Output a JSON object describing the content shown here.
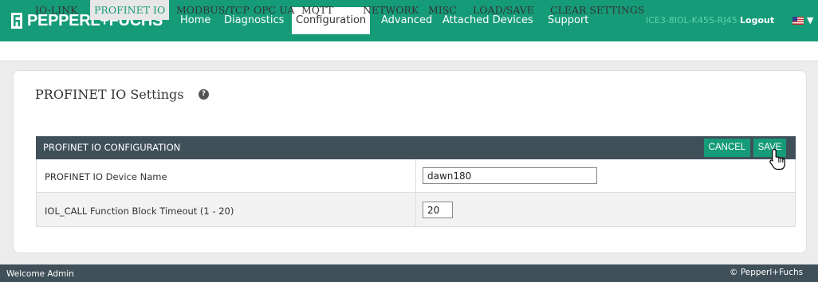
{
  "brand": {
    "name": "PEPPERL+FUCHS"
  },
  "nav": {
    "items": [
      "Home",
      "Diagnostics",
      "Configuration",
      "Advanced",
      "Attached Devices",
      "Support"
    ],
    "active": "Configuration",
    "device_id": "ICE3-8IOL-K45S-RJ45",
    "logout": "Logout",
    "language_icon": "us-flag-icon"
  },
  "subnav": {
    "items": [
      "IO-LINK",
      "PROFINET IO",
      "MODBUS/TCP",
      "OPC UA",
      "MQTT",
      "NETWORK",
      "MISC",
      "LOAD/SAVE",
      "CLEAR SETTINGS"
    ],
    "active": "PROFINET IO"
  },
  "page": {
    "title": "PROFINET IO Settings"
  },
  "config": {
    "title": "PROFINET IO CONFIGURATION",
    "cancel_label": "CANCEL",
    "save_label": "SAVE",
    "rows": [
      {
        "label": "PROFINET IO Device Name",
        "value": "dawn180"
      },
      {
        "label": "IOL_CALL Function Block Timeout (1 - 20)",
        "value": "20"
      }
    ]
  },
  "footer": {
    "welcome": "Welcome Admin",
    "copyright": "© Pepperl+Fuchs"
  },
  "colors": {
    "accent": "#169b78",
    "header": "#3f5059",
    "device_id": "#5fd3ad"
  }
}
